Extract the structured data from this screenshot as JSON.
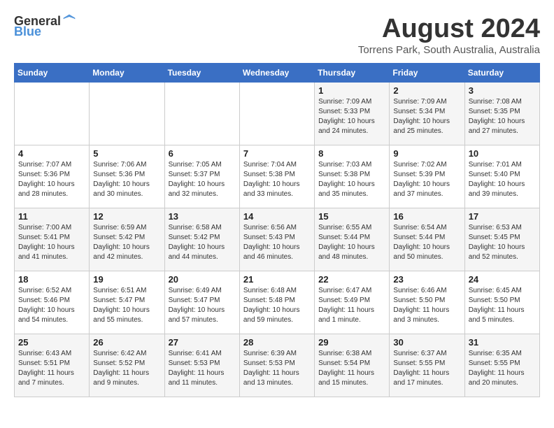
{
  "logo": {
    "text_general": "General",
    "text_blue": "Blue"
  },
  "title": {
    "month_year": "August 2024",
    "location": "Torrens Park, South Australia, Australia"
  },
  "days_of_week": [
    "Sunday",
    "Monday",
    "Tuesday",
    "Wednesday",
    "Thursday",
    "Friday",
    "Saturday"
  ],
  "weeks": [
    [
      {
        "day": "",
        "content": ""
      },
      {
        "day": "",
        "content": ""
      },
      {
        "day": "",
        "content": ""
      },
      {
        "day": "",
        "content": ""
      },
      {
        "day": "1",
        "content": "Sunrise: 7:09 AM\nSunset: 5:33 PM\nDaylight: 10 hours\nand 24 minutes."
      },
      {
        "day": "2",
        "content": "Sunrise: 7:09 AM\nSunset: 5:34 PM\nDaylight: 10 hours\nand 25 minutes."
      },
      {
        "day": "3",
        "content": "Sunrise: 7:08 AM\nSunset: 5:35 PM\nDaylight: 10 hours\nand 27 minutes."
      }
    ],
    [
      {
        "day": "4",
        "content": "Sunrise: 7:07 AM\nSunset: 5:36 PM\nDaylight: 10 hours\nand 28 minutes."
      },
      {
        "day": "5",
        "content": "Sunrise: 7:06 AM\nSunset: 5:36 PM\nDaylight: 10 hours\nand 30 minutes."
      },
      {
        "day": "6",
        "content": "Sunrise: 7:05 AM\nSunset: 5:37 PM\nDaylight: 10 hours\nand 32 minutes."
      },
      {
        "day": "7",
        "content": "Sunrise: 7:04 AM\nSunset: 5:38 PM\nDaylight: 10 hours\nand 33 minutes."
      },
      {
        "day": "8",
        "content": "Sunrise: 7:03 AM\nSunset: 5:38 PM\nDaylight: 10 hours\nand 35 minutes."
      },
      {
        "day": "9",
        "content": "Sunrise: 7:02 AM\nSunset: 5:39 PM\nDaylight: 10 hours\nand 37 minutes."
      },
      {
        "day": "10",
        "content": "Sunrise: 7:01 AM\nSunset: 5:40 PM\nDaylight: 10 hours\nand 39 minutes."
      }
    ],
    [
      {
        "day": "11",
        "content": "Sunrise: 7:00 AM\nSunset: 5:41 PM\nDaylight: 10 hours\nand 41 minutes."
      },
      {
        "day": "12",
        "content": "Sunrise: 6:59 AM\nSunset: 5:42 PM\nDaylight: 10 hours\nand 42 minutes."
      },
      {
        "day": "13",
        "content": "Sunrise: 6:58 AM\nSunset: 5:42 PM\nDaylight: 10 hours\nand 44 minutes."
      },
      {
        "day": "14",
        "content": "Sunrise: 6:56 AM\nSunset: 5:43 PM\nDaylight: 10 hours\nand 46 minutes."
      },
      {
        "day": "15",
        "content": "Sunrise: 6:55 AM\nSunset: 5:44 PM\nDaylight: 10 hours\nand 48 minutes."
      },
      {
        "day": "16",
        "content": "Sunrise: 6:54 AM\nSunset: 5:44 PM\nDaylight: 10 hours\nand 50 minutes."
      },
      {
        "day": "17",
        "content": "Sunrise: 6:53 AM\nSunset: 5:45 PM\nDaylight: 10 hours\nand 52 minutes."
      }
    ],
    [
      {
        "day": "18",
        "content": "Sunrise: 6:52 AM\nSunset: 5:46 PM\nDaylight: 10 hours\nand 54 minutes."
      },
      {
        "day": "19",
        "content": "Sunrise: 6:51 AM\nSunset: 5:47 PM\nDaylight: 10 hours\nand 55 minutes."
      },
      {
        "day": "20",
        "content": "Sunrise: 6:49 AM\nSunset: 5:47 PM\nDaylight: 10 hours\nand 57 minutes."
      },
      {
        "day": "21",
        "content": "Sunrise: 6:48 AM\nSunset: 5:48 PM\nDaylight: 10 hours\nand 59 minutes."
      },
      {
        "day": "22",
        "content": "Sunrise: 6:47 AM\nSunset: 5:49 PM\nDaylight: 11 hours\nand 1 minute."
      },
      {
        "day": "23",
        "content": "Sunrise: 6:46 AM\nSunset: 5:50 PM\nDaylight: 11 hours\nand 3 minutes."
      },
      {
        "day": "24",
        "content": "Sunrise: 6:45 AM\nSunset: 5:50 PM\nDaylight: 11 hours\nand 5 minutes."
      }
    ],
    [
      {
        "day": "25",
        "content": "Sunrise: 6:43 AM\nSunset: 5:51 PM\nDaylight: 11 hours\nand 7 minutes."
      },
      {
        "day": "26",
        "content": "Sunrise: 6:42 AM\nSunset: 5:52 PM\nDaylight: 11 hours\nand 9 minutes."
      },
      {
        "day": "27",
        "content": "Sunrise: 6:41 AM\nSunset: 5:53 PM\nDaylight: 11 hours\nand 11 minutes."
      },
      {
        "day": "28",
        "content": "Sunrise: 6:39 AM\nSunset: 5:53 PM\nDaylight: 11 hours\nand 13 minutes."
      },
      {
        "day": "29",
        "content": "Sunrise: 6:38 AM\nSunset: 5:54 PM\nDaylight: 11 hours\nand 15 minutes."
      },
      {
        "day": "30",
        "content": "Sunrise: 6:37 AM\nSunset: 5:55 PM\nDaylight: 11 hours\nand 17 minutes."
      },
      {
        "day": "31",
        "content": "Sunrise: 6:35 AM\nSunset: 5:55 PM\nDaylight: 11 hours\nand 20 minutes."
      }
    ]
  ]
}
